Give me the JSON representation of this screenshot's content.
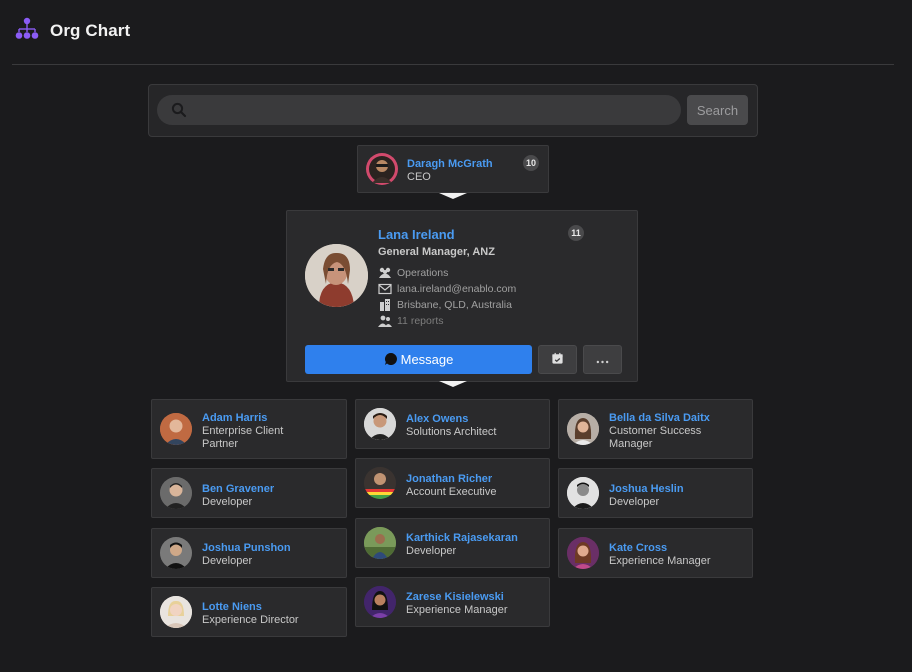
{
  "app": {
    "title": "Org Chart"
  },
  "search": {
    "placeholder": "",
    "value": "",
    "button_label": "Search"
  },
  "ceo": {
    "name": "Daragh McGrath",
    "title": "CEO",
    "count": "10"
  },
  "focus": {
    "name": "Lana Ireland",
    "title": "General Manager, ANZ",
    "count": "11",
    "department": "Operations",
    "email": "lana.ireland@enablo.com",
    "location": "Brisbane, QLD, Australia",
    "reports": "11 reports",
    "message_label": "Message"
  },
  "reports": [
    {
      "name": "Adam Harris",
      "title": "Enterprise Client Partner"
    },
    {
      "name": "Ben Gravener",
      "title": "Developer"
    },
    {
      "name": "Joshua Punshon",
      "title": "Developer"
    },
    {
      "name": "Lotte Niens",
      "title": "Experience Director"
    },
    {
      "name": "Alex Owens",
      "title": "Solutions Architect"
    },
    {
      "name": "Jonathan Richer",
      "title": "Account Executive"
    },
    {
      "name": "Karthick Rajasekaran",
      "title": "Developer"
    },
    {
      "name": "Zarese Kisielewski",
      "title": "Experience Manager"
    },
    {
      "name": "Bella da Silva Daitx",
      "title": "Customer Success Manager"
    },
    {
      "name": "Joshua Heslin",
      "title": "Developer"
    },
    {
      "name": "Kate Cross",
      "title": "Experience Manager"
    }
  ],
  "colors": {
    "accent": "#2f80ed",
    "link": "#4a9bf2",
    "logo": "#8b5cf6",
    "background": "#1b1b1d"
  }
}
